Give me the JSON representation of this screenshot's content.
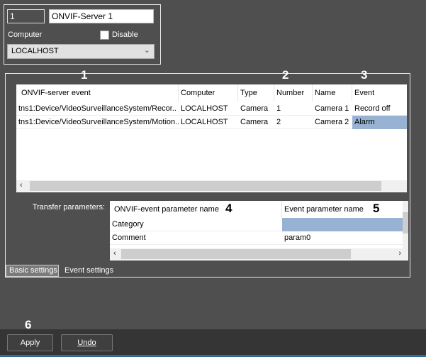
{
  "server": {
    "id": "1",
    "name": "ONVIF-Server 1",
    "computer_label": "Computer",
    "disable_label": "Disable",
    "disable_checked": false,
    "computer_value": "LOCALHOST"
  },
  "annotations": [
    "1",
    "2",
    "3",
    "4",
    "5",
    "6"
  ],
  "events_table": {
    "columns": [
      "ONVIF-server event",
      "Computer",
      "Type",
      "Number",
      "Name",
      "Event"
    ],
    "rows": [
      [
        "tns1:Device/VideoSurveillanceSystem/Recor..",
        "LOCALHOST",
        "Camera",
        "1",
        "Camera 1",
        "Record off"
      ],
      [
        "tns1:Device/VideoSurveillanceSystem/Motion..",
        "LOCALHOST",
        "Camera",
        "2",
        "Camera 2",
        "Alarm"
      ]
    ]
  },
  "transfer": {
    "label": "Transfer parameters:",
    "columns": [
      "ONVIF-event parameter name",
      "Event parameter name"
    ],
    "rows": [
      [
        "Category",
        ""
      ],
      [
        "Comment",
        "param0"
      ]
    ]
  },
  "tabs": [
    "Basic settings",
    "Event settings"
  ],
  "buttons": {
    "apply": "Apply",
    "undo": "Undo"
  },
  "colors": {
    "selection": "#97b2d3"
  }
}
